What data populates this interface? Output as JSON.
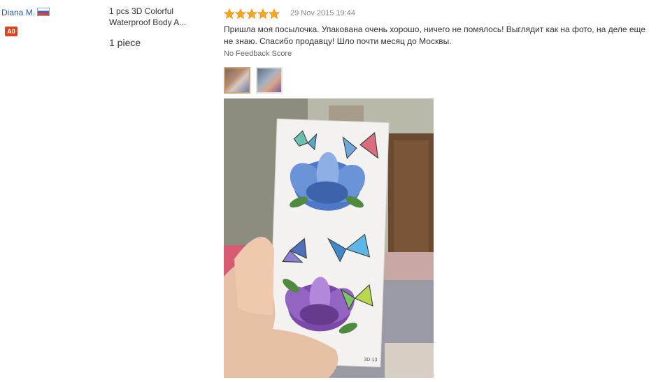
{
  "user": {
    "name": "Diana M.",
    "flag_icon": "russia-flag-icon",
    "level": "A0"
  },
  "product": {
    "title": "1 pcs 3D Colorful Waterproof Body A...",
    "quantity": "1 piece"
  },
  "review": {
    "rating": 5,
    "date": "29 Nov 2015 19:44",
    "text": "Пришла моя посылочка. Упакована очень хорошо, ничего не помялось! Выглядит как на фото, на деле еще не знаю. Спасибо продавцу! Шло почти месяц до Москвы.",
    "feedback_score": "No Feedback Score",
    "sticker_label": "3D-13"
  },
  "colors": {
    "username": "#2a5c9a",
    "star": "#f5a623",
    "level_badge": "#d84422"
  }
}
